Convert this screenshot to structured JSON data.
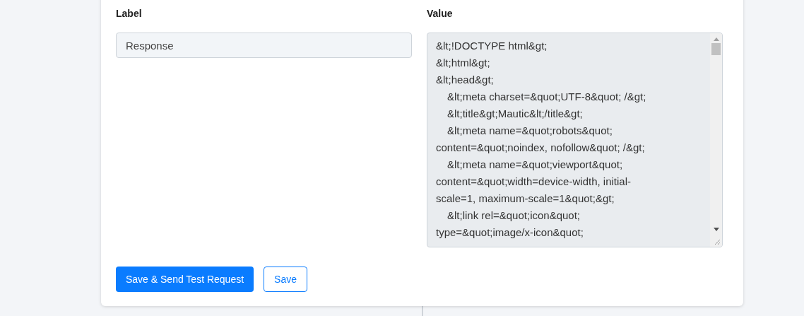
{
  "label_field": {
    "label": "Label",
    "value": "Response"
  },
  "value_field": {
    "label": "Value",
    "lines": [
      {
        "text": "&lt;!DOCTYPE html&gt;",
        "indented": false
      },
      {
        "text": "&lt;html&gt;",
        "indented": false
      },
      {
        "text": "&lt;head&gt;",
        "indented": false
      },
      {
        "text": "&lt;meta charset=&quot;UTF-8&quot; /&gt;",
        "indented": true
      },
      {
        "text": "&lt;title&gt;Mautic&lt;/title&gt;",
        "indented": true
      },
      {
        "text": "&lt;meta name=&quot;robots&quot;",
        "indented": true
      },
      {
        "text": "content=&quot;noindex, nofollow&quot; /&gt;",
        "indented": false
      },
      {
        "text": "&lt;meta name=&quot;viewport&quot;",
        "indented": true
      },
      {
        "text": "content=&quot;width=device-width, initial-",
        "indented": false
      },
      {
        "text": "scale=1, maximum-scale=1&quot;&gt;",
        "indented": false
      },
      {
        "text": "&lt;link rel=&quot;icon&quot;",
        "indented": true
      },
      {
        "text": "type=&quot;image/x-icon&quot;",
        "indented": false
      }
    ]
  },
  "buttons": [
    {
      "label": "Save & Send Test Request",
      "kind": "primary"
    },
    {
      "label": "Save",
      "kind": "outline"
    }
  ]
}
